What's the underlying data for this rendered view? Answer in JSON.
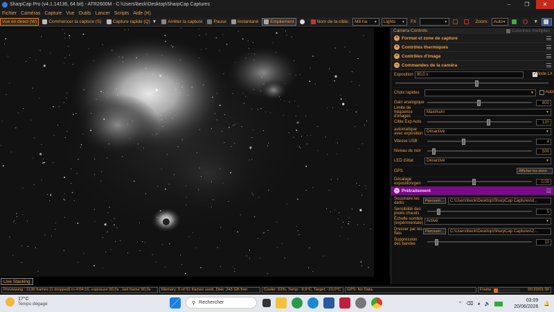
{
  "window": {
    "title": "SharpCap Pro (v4.1.14136, 64 bit) - ATR2600M - C:\\Users\\beck\\Desktop\\SharpCap Captures"
  },
  "menu": [
    "Fichier",
    "Caméras",
    "Capture",
    "Vue",
    "Outils",
    "Lancer",
    "Scripts",
    "Aide (H)"
  ],
  "toolbar": {
    "live_view": "Vue en direct (W)",
    "start_capture": "Commencer la capture (S)",
    "quick_capture": "Capture rapide (Q)",
    "stop_capture": "Arrêter la capture",
    "pause": "Pause",
    "snapshot": "Instantané",
    "stacking": "Empilement",
    "target_label": "Nom de la cible:",
    "target_value": "M8 ha",
    "frame_type": "Lights",
    "fx_label": "FX",
    "fx_value": "",
    "zoom_label": "Zoom:",
    "zoom_value": "Auto"
  },
  "panel": {
    "header": "Camera Controls",
    "multi_columns": "Colonnes multiples",
    "sections": {
      "format": "Format et zone de capture",
      "thermal": "Contrôles thermiques",
      "image": "Contrôles d'image",
      "camera": "Commandes de la caméra",
      "preprocessing": "Prétraitement"
    },
    "exposure": {
      "label": "Exposition",
      "value": "90,0 s",
      "lx_mode": "Mode LX"
    },
    "quick_choice": {
      "label": "Choix rapides",
      "value": "",
      "auto": "Auto"
    },
    "gain": {
      "label": "Gain analogique",
      "value": "800",
      "level": 0.5
    },
    "frame_rate_limit": {
      "label": "Limite de fréquence d'images",
      "value": "Maximum"
    },
    "auto_exposure_target": {
      "label": "Cible Exp Auto",
      "value": "120",
      "level": 0.6
    },
    "auto_exposure": {
      "label": "automatique avec exposition",
      "value": "Désactivé"
    },
    "usb_speed": {
      "label": "Vitesse USB",
      "value": "4",
      "level": 0.35
    },
    "black_level": {
      "label": "Niveau de noir",
      "value": "500",
      "level": 0.05
    },
    "led": {
      "label": "LED d'état",
      "value": "Désactivé"
    },
    "gps": {
      "label": "GPS",
      "button": "Afficher les donn"
    },
    "exposure_offset": {
      "label": "Décalage exposition/gen",
      "value": "0,00",
      "level": 0.45
    },
    "subtract_darks": {
      "label": "Soustraire les darks",
      "browse": "Parcourir...",
      "path": "C:\\Users\\beck\\Desktop\\SharpCap Captures\\d..."
    },
    "hot_pixel": {
      "label": "Sensibilité des pixels chauds",
      "value": "5",
      "level": 0.1
    },
    "dark_scale": {
      "label": "Échelle sombre (expérimentale)",
      "value": "Activé"
    },
    "flat": {
      "label": "Dresser par les flats",
      "browse": "Parcourir...",
      "path": "C:\\Users\\beck\\Desktop\\SharpCap Captures\\2..."
    },
    "banding": {
      "label": "Suppression des bandes",
      "value": "10",
      "level": 0.08
    }
  },
  "live_stacking": "Live Stacking",
  "status": {
    "previewing": "Previewing : 1130 frames (1 dropped) in 4:04:16, exposure 90,0s , last frame 90,0s",
    "memory": "Memory: 5 of 51 frames used, Disk: 243 GB free",
    "cooler": "Cooler: 52%, Temp: -9,9°C, Target: -10,0°C",
    "gps": "GPS: No Data",
    "frame_label": "Frame :",
    "frame_progress": 0.15,
    "elapsed": "00:20/01:30"
  },
  "taskbar": {
    "temp": "17°C",
    "weather": "Temps dégagé",
    "search": "Rechercher",
    "time": "03:09",
    "date": "20/06/2026"
  }
}
